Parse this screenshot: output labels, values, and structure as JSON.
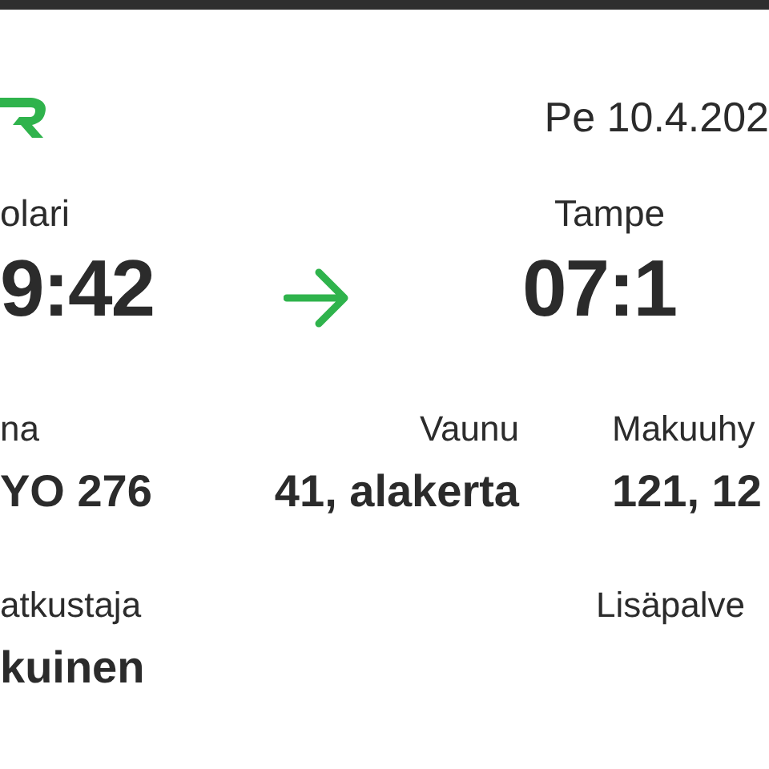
{
  "header": {
    "date": "Pe 10.4.202"
  },
  "route": {
    "from": {
      "station": "olari",
      "time": "9:42"
    },
    "to": {
      "station": "Tampe",
      "time": "07:1"
    }
  },
  "details": [
    {
      "cells": [
        {
          "label": "na",
          "value": "YO 276"
        },
        {
          "label": "Vaunu",
          "value": "41, alakerta"
        },
        {
          "label": "Makuuhy",
          "value": "121, 12"
        }
      ]
    },
    {
      "cells": [
        {
          "label": "atkustaja",
          "value": "kuinen"
        },
        {
          "label": "Lisäpalve"
        }
      ]
    }
  ]
}
